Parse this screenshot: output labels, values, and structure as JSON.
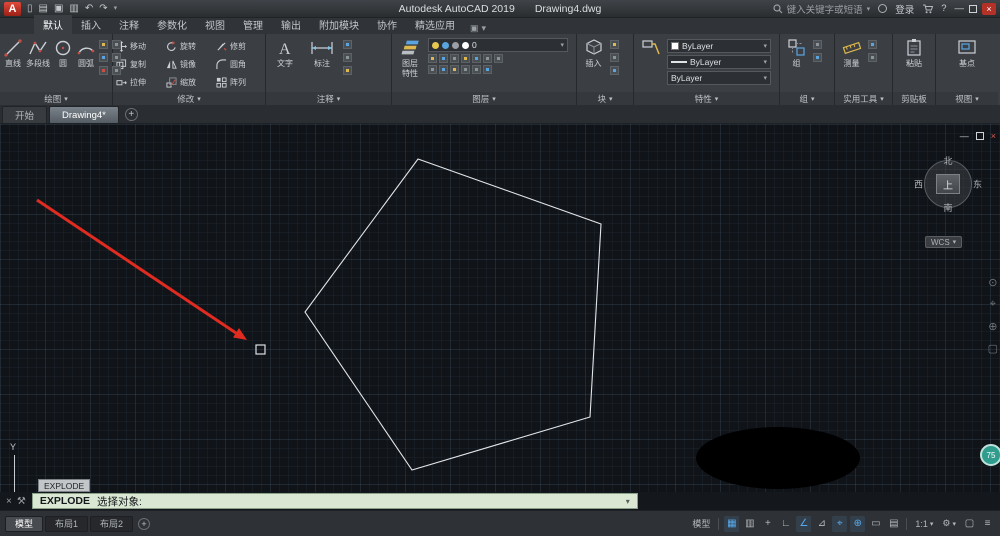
{
  "ui": {
    "caret": "▾"
  },
  "icons": {
    "close": "×",
    "min": "—",
    "undo": "↶",
    "redo": "↷",
    "caret": "▾",
    "wrench": "⚒",
    "gear": "⚙",
    "grid": "▦",
    "snap": "▥",
    "infer": "+",
    "ortho": "∟",
    "polar": "∠",
    "iso": "⊿",
    "otrack": "⌖",
    "osnap": "⊕",
    "lwt": "▭",
    "dyn": "≡",
    "sel": "▤",
    "menu": "≡",
    "wheel": "⊙",
    "target": "⌖",
    "zoom": "⊕",
    "box": "▢",
    "help": "?"
  },
  "titlebar": {
    "logo": "A",
    "app_title": "Autodesk AutoCAD 2019",
    "doc_title": "Drawing4.dwg",
    "search_placeholder": "键入关键字或短语",
    "signin": "登录"
  },
  "ribbon_tabs": [
    "默认",
    "插入",
    "注释",
    "参数化",
    "视图",
    "管理",
    "输出",
    "附加模块",
    "协作",
    "精选应用"
  ],
  "panels": {
    "draw": {
      "label": "绘图",
      "items": [
        "直线",
        "多段线",
        "圆",
        "圆弧"
      ]
    },
    "modify": {
      "label": "修改",
      "items": [
        "移动",
        "旋转",
        "修剪",
        "复制",
        "镜像",
        "圆角",
        "拉伸",
        "缩放",
        "阵列"
      ]
    },
    "annotate": {
      "label": "注释",
      "items": [
        "文字",
        "标注"
      ]
    },
    "layers": {
      "label": "图层",
      "big_line1": "图层",
      "big_line2": "特性",
      "current_layer": "0"
    },
    "block": {
      "label": "块",
      "big": "插入"
    },
    "props": {
      "label": "特性",
      "dropdowns": [
        "ByLayer",
        "ByLayer",
        "ByLayer"
      ]
    },
    "groups": {
      "label": "组",
      "big": "组"
    },
    "utils": {
      "label": "实用工具",
      "big": "测量"
    },
    "clipboard": {
      "label": "剪贴板",
      "big": "粘贴"
    },
    "view": {
      "label": "视图",
      "big": "基点"
    }
  },
  "file_tabs": {
    "start": "开始",
    "doc": "Drawing4*",
    "add": "+"
  },
  "canvas": {
    "viewcube": {
      "n": "北",
      "w": "西",
      "e": "东",
      "s": "南",
      "top": "上",
      "wcs": "WCS"
    },
    "axis_y": "Y",
    "badge": "75"
  },
  "command": {
    "tooltip": "EXPLODE",
    "cmd": "EXPLODE",
    "prompt": "选择对象:"
  },
  "layout_tabs": {
    "model": "模型",
    "layout1": "布局1",
    "layout2": "布局2",
    "add": "+"
  },
  "status": {
    "model": "模型",
    "scale": "1:1"
  },
  "colors": {
    "arrow_red": "#e02b20",
    "cmd_green": "#d9e7d3",
    "active_blue": "#58a9ec"
  }
}
